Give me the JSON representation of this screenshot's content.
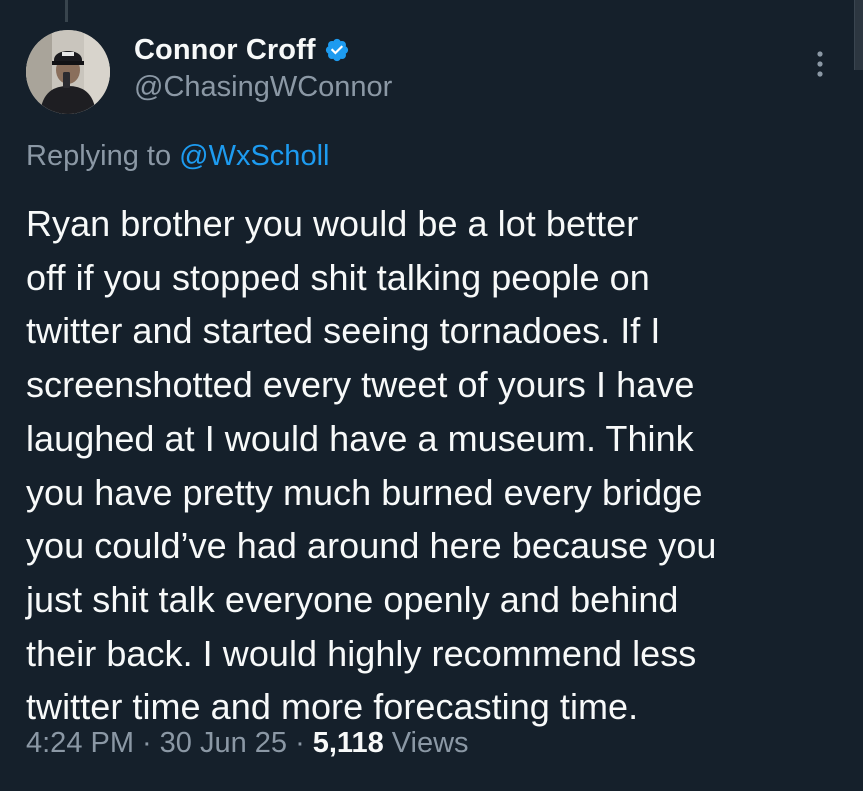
{
  "author": {
    "display_name": "Connor Croff",
    "handle": "@ChasingWConnor",
    "verified_icon": "verified-badge-icon",
    "verified_color": "#1d9bf0"
  },
  "reply": {
    "prefix": "Replying to",
    "mention": "@WxScholl"
  },
  "tweet": {
    "text": "Ryan brother you would be a lot better\noff if you stopped shit talking people on\ntwitter and started seeing tornadoes. If I\nscreenshotted every tweet of yours I have\nlaughed at I would have a museum. Think\nyou have pretty much burned every bridge\nyou could’ve had around here because you\njust shit talk everyone openly and behind\ntheir back. I would highly recommend less\ntwitter time and more forecasting time."
  },
  "meta": {
    "time": "4:24 PM",
    "separator": "·",
    "date": "30 Jun 25",
    "views_count": "5,118",
    "views_label": "Views"
  },
  "colors": {
    "background": "#15202b",
    "text_primary": "#f7f9f9",
    "text_secondary": "#8b98a5",
    "accent": "#1d9bf0"
  }
}
